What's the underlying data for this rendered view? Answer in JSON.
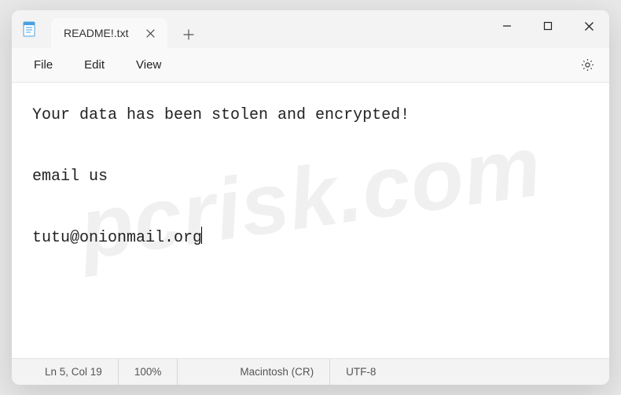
{
  "tab": {
    "title": "README!.txt"
  },
  "menu": {
    "file": "File",
    "edit": "Edit",
    "view": "View"
  },
  "content": {
    "line1": "Your data has been stolen and encrypted!",
    "line2": "email us",
    "line3": "tutu@onionmail.org"
  },
  "status": {
    "position": "Ln 5, Col 19",
    "zoom": "100%",
    "line_ending": "Macintosh (CR)",
    "encoding": "UTF-8"
  },
  "watermark": "pcrisk.com"
}
